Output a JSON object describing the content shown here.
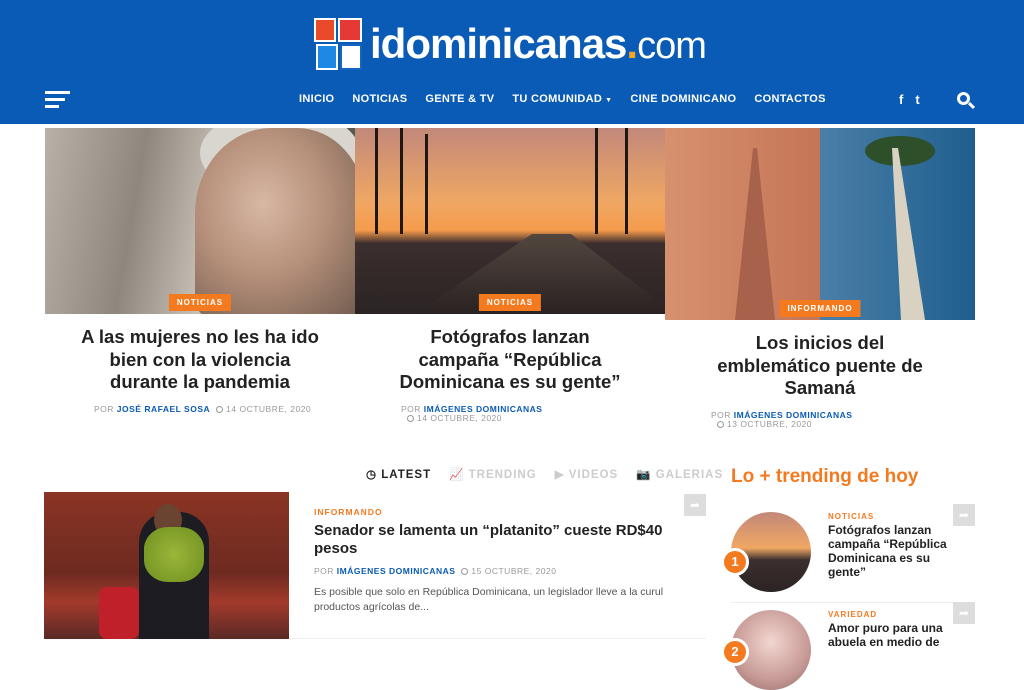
{
  "site": {
    "logo_main": "idominicanas",
    "logo_suffix": "com"
  },
  "nav": {
    "items": [
      "INICIO",
      "NOTICIAS",
      "GENTE & TV",
      "TU COMUNIDAD",
      "CINE DOMINICANO",
      "CONTACTOS"
    ],
    "social": [
      "f",
      "t"
    ]
  },
  "featured": [
    {
      "category": "NOTICIAS",
      "title": "A las mujeres no les ha ido bien con la violencia durante la pandemia",
      "by": "POR",
      "author": "JOSÉ RAFAEL SOSA",
      "date": "14 OCTUBRE, 2020"
    },
    {
      "category": "NOTICIAS",
      "title": "Fotógrafos lanzan campaña “República Dominicana es su gente”",
      "by": "POR",
      "author": "IMÁGENES DOMINICANAS",
      "date": "14 OCTUBRE, 2020"
    },
    {
      "category": "INFORMANDO",
      "title": "Los inicios del emblemático puente de Samaná",
      "by": "POR",
      "author": "IMÁGENES DOMINICANAS",
      "date": "13 OCTUBRE, 2020"
    }
  ],
  "tabs": [
    "LATEST",
    "TRENDING",
    "VIDEOS",
    "GALERIAS"
  ],
  "post": {
    "category": "INFORMANDO",
    "title": "Senador se lamenta un “platanito” cueste RD$40 pesos",
    "by": "POR",
    "author": "IMÁGENES DOMINICANAS",
    "date": "15 OCTUBRE, 2020",
    "excerpt": "Es posible que solo en República Dominicana, un legislador lleve a la curul productos agrícolas de..."
  },
  "sidebar": {
    "title": "Lo + trending de hoy",
    "items": [
      {
        "rank": "1",
        "category": "NOTICIAS",
        "title": "Fotógrafos lanzan campaña “República Dominicana es su gente”"
      },
      {
        "rank": "2",
        "category": "VARIEDAD",
        "title": "Amor puro para una abuela en medio de"
      }
    ]
  },
  "colors": {
    "header": "#0a5bb5",
    "accent": "#f47a20"
  },
  "icons": {
    "menu": "hamburger-icon",
    "search": "search-icon",
    "share": "share-icon",
    "clock": "clock-icon"
  }
}
